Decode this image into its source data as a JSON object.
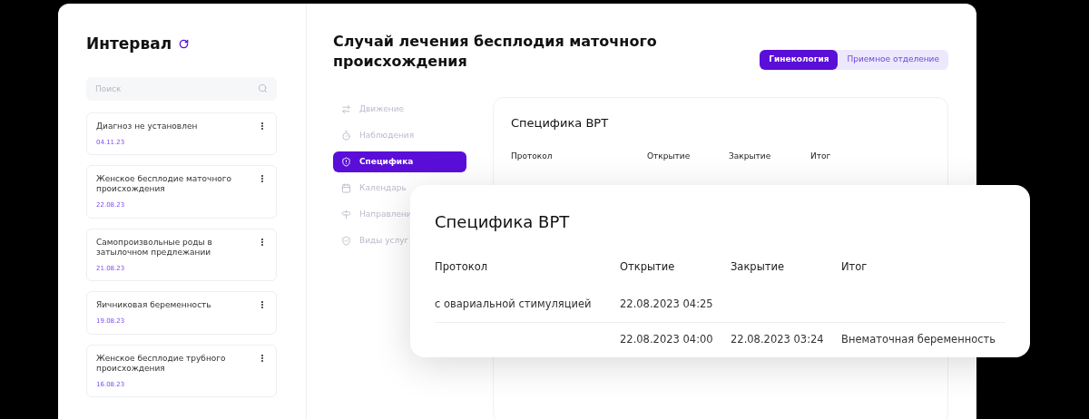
{
  "sidebar": {
    "title": "Интервал",
    "search": {
      "placeholder": "Поиск"
    },
    "items": [
      {
        "title": "Диагноз не установлен",
        "date": "04.11.23"
      },
      {
        "title": "Женское бесплодие маточного происхождения",
        "date": "22.08.23"
      },
      {
        "title": "Самопроизвольные роды в затылочном предлежании",
        "date": "21.08.23"
      },
      {
        "title": "Яичниковая беременность",
        "date": "19.08.23"
      },
      {
        "title": "Женское бесплодие трубного происхождения",
        "date": "16.08.23"
      }
    ]
  },
  "main": {
    "title": "Случай лечения бесплодия маточного происхождения",
    "tabs": [
      {
        "label": "Гинекология",
        "selected": true
      },
      {
        "label": "Приемное отделение",
        "selected": false
      }
    ],
    "nav": [
      {
        "label": "Движение",
        "selected": false
      },
      {
        "label": "Наблюдения",
        "selected": false
      },
      {
        "label": "Специфика",
        "selected": true
      },
      {
        "label": "Календарь",
        "selected": false
      },
      {
        "label": "Направлени",
        "selected": false
      },
      {
        "label": "Виды услуг",
        "selected": false
      }
    ],
    "background_card": {
      "title": "Специфика ВРТ",
      "columns": [
        "Протокол",
        "Открытие",
        "Закрытие",
        "Итог"
      ]
    },
    "popup_card": {
      "title": "Специфика ВРТ",
      "columns": [
        "Протокол",
        "Открытие",
        "Закрытие",
        "Итог"
      ],
      "rows": [
        [
          "с овариальной стимуляцией",
          "22.08.2023 04:25",
          "",
          ""
        ],
        [
          "",
          "22.08.2023 04:00",
          "22.08.2023 03:24",
          "Внематочная беременность"
        ]
      ]
    }
  }
}
